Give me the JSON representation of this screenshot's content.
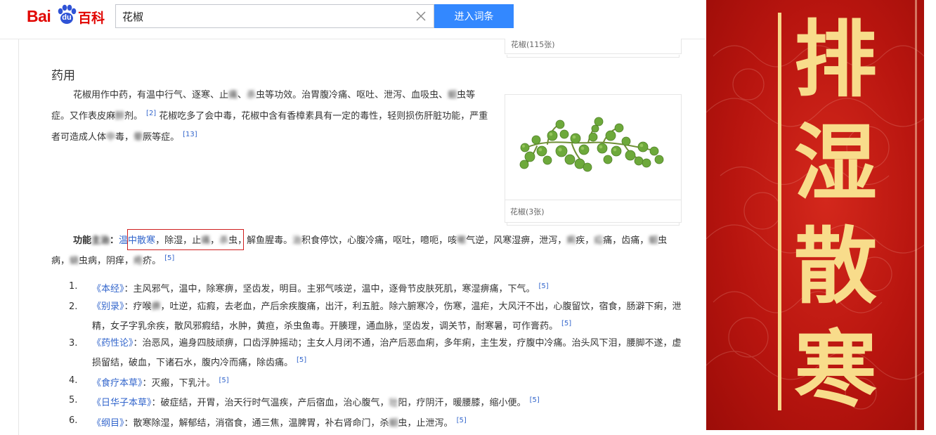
{
  "header": {
    "logo": {
      "bai": "Bai",
      "du": "du",
      "baike": "百科"
    },
    "search": {
      "value": "花椒"
    },
    "search_button_label": "进入词条"
  },
  "section": {
    "title": "药用",
    "para1": {
      "t1": "花椒用作中药，有温中行气、逐寒、止",
      "b1": "痛",
      "t2": "、",
      "b2": "杀",
      "t3": "虫等功效。治胃腹冷痛、呕吐、泄泻、血吸虫、",
      "b3": "蛔",
      "t4": "虫等症。又作表皮麻",
      "b4": "醉",
      "t5": "剂。",
      "cite1": "[2]",
      "t6": "花椒吃多了会中毒，花椒中含有香樟素具有一定的毒性，轻则损伤肝脏功能，严重者可造成人体",
      "b5": "中",
      "t7": "毒，",
      "b6": "晕",
      "t8": "厥等症。",
      "cite2": "[13]"
    }
  },
  "album": {
    "top_caption": "花椒(115张)",
    "main_caption": "花椒(3张)"
  },
  "func": {
    "label_a": "功能",
    "label_blur": "主治",
    "label_b": "：",
    "link": "温中散寒",
    "t1": "，除湿，止",
    "b1": "痛",
    "t2": "，",
    "b2": "杀",
    "t3": "虫，解鱼腥毒。",
    "b3": "治",
    "t4": "积食停饮，心腹冷痛，呕吐，噫呃，咳",
    "b4": "嗽",
    "t5": "气逆，风寒湿痹，泄泻，",
    "b5": "痢",
    "t6": "疾，",
    "b6": "疝",
    "t7": "痛，齿痛，",
    "b7": "蛔",
    "t8": "虫病，",
    "b8": "蛲",
    "t9": "虫病，阴痒，",
    "b9": "疮",
    "t10": "疥。",
    "cite": "[5]"
  },
  "refs": [
    {
      "num": "1.",
      "book": "《本经》",
      "pre": "：主风邪气，温中，除寒痹，坚齿发，明目。主邪气咳逆，温中，逐骨节皮肤死肌，寒湿痹痛，下气。",
      "blur": "",
      "post": "",
      "cite": "[5]"
    },
    {
      "num": "2.",
      "book": "《别录》",
      "pre": "：疗喉",
      "blur": "痹",
      "post": "，吐逆，疝瘕，去老血，产后余疾腹痛，出汗，利五脏。除六腑寒冷，伤寒，温疟，大风汗不出，心腹留饮，宿食，肠澼下痢，泄精，女子字乳余疾，散风邪瘕结，水肿，黄疸，杀虫鱼毒。开腠理，通血脉，坚齿发，调关节，耐寒暑，可作膏药。",
      "cite": "[5]"
    },
    {
      "num": "3.",
      "book": "《药性论》",
      "pre": "：治恶风，遍身四肢顽痹，口齿浮肿摇动；主女人月闭不通，治产后恶血痢，多年痢，主生发，疗腹中冷痛。治头风下泪，腰脚不遂，虚损留结，破血，下诸石水，腹内冷而痛，除齿痛。",
      "blur": "",
      "post": "",
      "cite": "[5]"
    },
    {
      "num": "4.",
      "book": "《食疗本草》",
      "pre": "：灭瘢，下乳汁。",
      "blur": "",
      "post": "",
      "cite": "[5]"
    },
    {
      "num": "5.",
      "book": "《日华子本草》",
      "pre": "：破症结，开胃，治天行时气温疾，产后宿血，治心腹气，",
      "blur": "壮",
      "post": "阳，疗阴汗，暖腰膝，缩小便。",
      "cite": "[5]"
    },
    {
      "num": "6.",
      "book": "《纲目》",
      "pre": "：散寒除湿，解郁结，消宿食，通三焦，温脾胃，补右肾命门，杀",
      "blur": "蛔",
      "post": "虫，止泄泻。",
      "cite": "[5]"
    }
  ],
  "banner": {
    "chars": [
      "排",
      "湿",
      "散",
      "寒"
    ]
  },
  "colors": {
    "brand_red": "#e10602",
    "search_blue": "#3388ff",
    "link_blue": "#3366cc",
    "highlight_red": "#d01f1f",
    "banner_red": "#b8150f",
    "banner_gold": "#f8dc8b"
  }
}
